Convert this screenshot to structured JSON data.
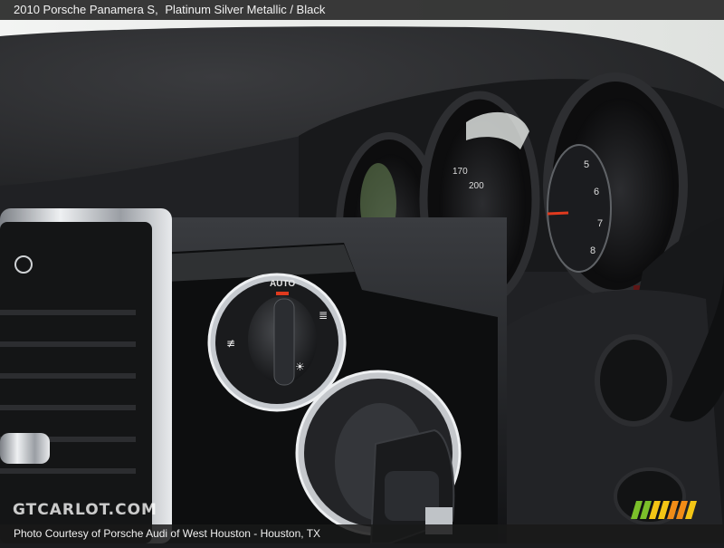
{
  "header": {
    "vehicle": "2010 Porsche Panamera S,",
    "colors": "Platinum Silver Metallic / Black"
  },
  "footer": {
    "credit": "Photo Courtesy of Porsche Audi of West Houston - Houston, TX"
  },
  "watermark": {
    "text": "GTCARLOT.COM"
  },
  "dash": {
    "light_switch_label": "AUTO",
    "speedo_top": "170",
    "speedo_top2": "200"
  },
  "colors": {
    "needle": "#e03a1e",
    "leather": "#2a2b2e",
    "chrome": "#c9cdd2",
    "stripe_green": "#7bbf2a",
    "stripe_yellow": "#f3c515",
    "stripe_orange": "#f28c17"
  }
}
